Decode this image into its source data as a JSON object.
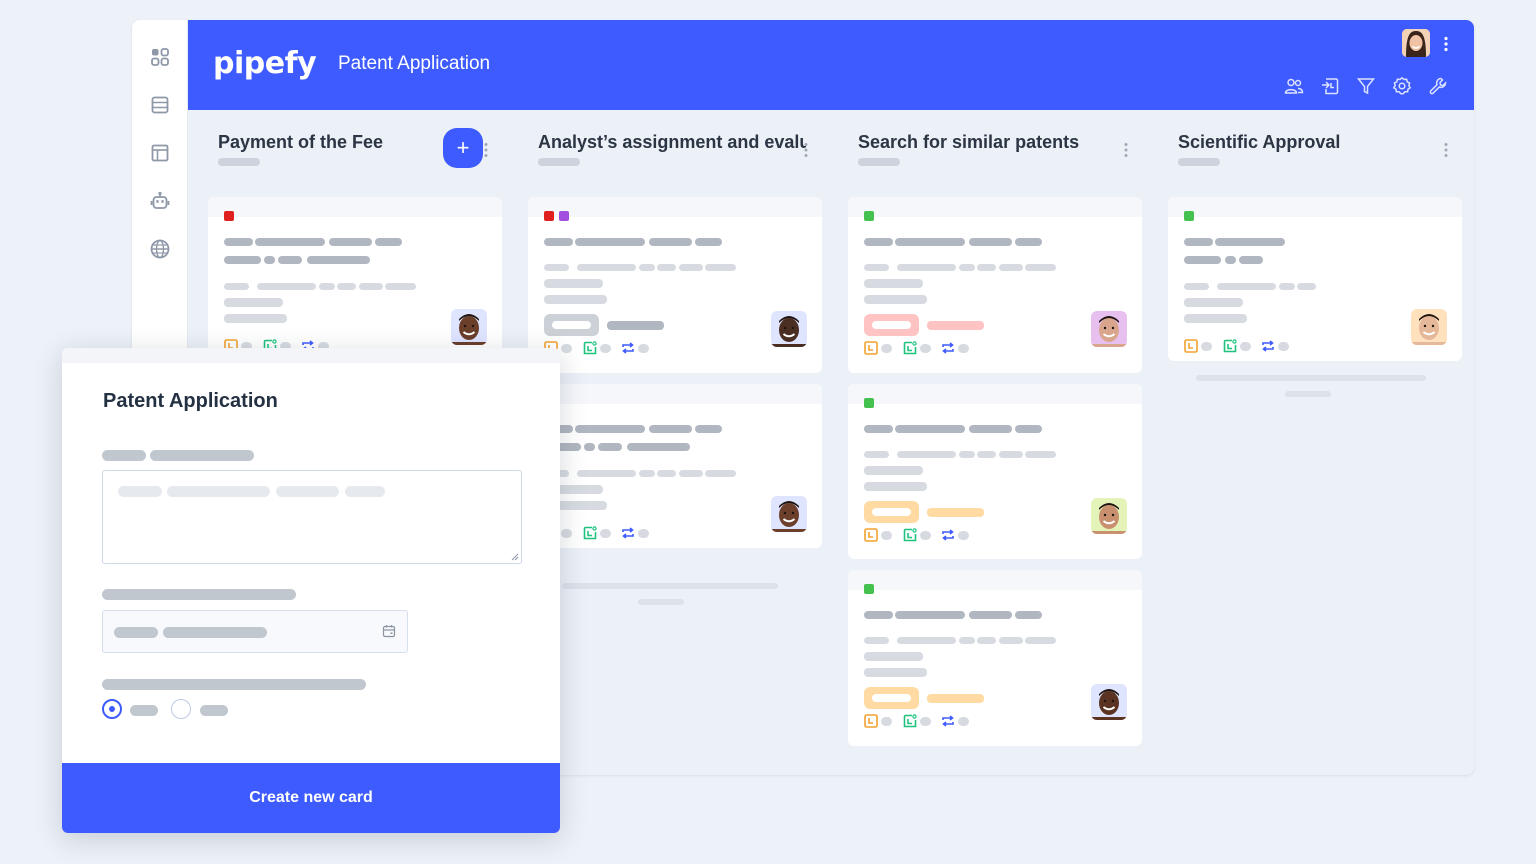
{
  "app": {
    "logo": "pipefy",
    "title": "Patent Application"
  },
  "sidebar": {
    "items": [
      {
        "icon": "grid-icon"
      },
      {
        "icon": "database-icon"
      },
      {
        "icon": "layout-icon"
      },
      {
        "icon": "robot-icon"
      },
      {
        "icon": "globe-icon"
      }
    ]
  },
  "header": {
    "actions": [
      "members-icon",
      "import-icon",
      "filter-icon",
      "settings-icon",
      "wrench-icon"
    ]
  },
  "columns": [
    {
      "title": "Payment of the Fee",
      "has_add": true,
      "add_label": "+"
    },
    {
      "title": "Analyst’s assignment and evalu",
      "has_add": false
    },
    {
      "title": "Search for similar patents",
      "has_add": false
    },
    {
      "title": "Scientific Approval",
      "has_add": false
    }
  ],
  "colors": {
    "brand": "#3e5bff",
    "label_red": "#e0201f",
    "label_purple": "#a24fe0",
    "label_green": "#45c150",
    "badge_pink": "#ffc3c3",
    "badge_orange": "#ffdaa3"
  },
  "modal": {
    "title": "Patent Application",
    "submit_label": "Create new card",
    "radio_selected": 0
  }
}
